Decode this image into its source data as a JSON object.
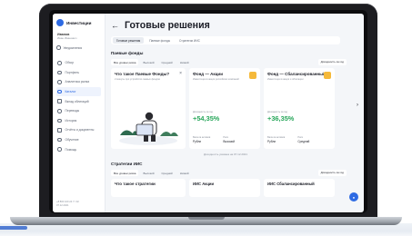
{
  "app": {
    "name": "Инвестиции"
  },
  "user": {
    "name": "Иванов",
    "sub": "Иван Иванович"
  },
  "sidebar": {
    "notifications": "Уведомления",
    "items": [
      {
        "label": "Обзор"
      },
      {
        "label": "Портфель"
      },
      {
        "label": "Аналитика рынка"
      },
      {
        "label": "Каталог"
      },
      {
        "label": "Вклад облигаций"
      },
      {
        "label": "Переводы"
      },
      {
        "label": "История"
      },
      {
        "label": "Отчёты и документы"
      },
      {
        "label": "Обучение"
      },
      {
        "label": "Помощь"
      }
    ],
    "active_index": 3,
    "footer_line1": "+8 800 100 24 7 / 02",
    "footer_line2": "07.12.2021"
  },
  "page": {
    "title": "Готовые решения",
    "tabs": [
      "Готовые решения",
      "Паевые фонды",
      "Стратегии ИИС"
    ]
  },
  "funds": {
    "title": "Паевые фонды",
    "filters": [
      "Все уровни риска",
      "Высокий",
      "Средний",
      "Низкий"
    ],
    "sort": "Доходность за год",
    "promo": {
      "title": "Что такое Паевые Фонды?",
      "desc": "2 минуты про устройство паевых фондов"
    },
    "cards": [
      {
        "name": "Фонд — Акции",
        "desc": "Инвестиции в акции российских компаний",
        "kpi_label": "Доходность за год",
        "kpi": "+54,35%",
        "currency_label": "Валюта активов",
        "currency": "Рубли",
        "risk_label": "Риск",
        "risk": "Высокий"
      },
      {
        "name": "Фонд — Сбалансированный",
        "desc": "Инвестиции в акции и облигации",
        "kpi_label": "Доходность за год",
        "kpi": "+36,35%",
        "currency_label": "Валюта активов",
        "currency": "Рубли",
        "risk_label": "Риск",
        "risk": "Средний"
      }
    ],
    "updated": "Доходность указана на 07.12.2021"
  },
  "iis": {
    "title": "Стратегии ИИС",
    "filters": [
      "Все уровни риска",
      "Высокий",
      "Средний",
      "Низкий"
    ],
    "sort": "Доходность за год",
    "promo_title": "Что такое стратегии",
    "cards": [
      "ИИС Акции",
      "ИИС Сбалансированный"
    ]
  },
  "colors": {
    "accent": "#2d6ae3",
    "positive": "#27a65a",
    "fund_icon": "#f5b93a"
  }
}
